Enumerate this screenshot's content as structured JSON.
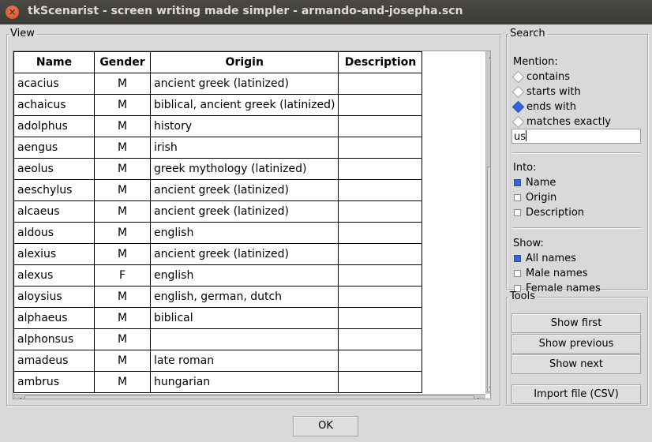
{
  "window": {
    "title": "tkScenarist - screen writing made simpler - armando-and-josepha.scn",
    "close_glyph": "×"
  },
  "view": {
    "legend": "View",
    "columns": [
      "Name",
      "Gender",
      "Origin",
      "Description"
    ],
    "rows": [
      [
        "acacius",
        "M",
        "ancient greek (latinized)",
        ""
      ],
      [
        "achaicus",
        "M",
        "biblical, ancient greek (latinized)",
        ""
      ],
      [
        "adolphus",
        "M",
        "history",
        ""
      ],
      [
        "aengus",
        "M",
        "irish",
        ""
      ],
      [
        "aeolus",
        "M",
        "greek mythology (latinized)",
        ""
      ],
      [
        "aeschylus",
        "M",
        "ancient greek (latinized)",
        ""
      ],
      [
        "alcaeus",
        "M",
        "ancient greek (latinized)",
        ""
      ],
      [
        "aldous",
        "M",
        "english",
        ""
      ],
      [
        "alexius",
        "M",
        "ancient greek (latinized)",
        ""
      ],
      [
        "alexus",
        "F",
        "english",
        ""
      ],
      [
        "aloysius",
        "M",
        "english, german, dutch",
        ""
      ],
      [
        "alphaeus",
        "M",
        "biblical",
        ""
      ],
      [
        "alphonsus",
        "M",
        "",
        ""
      ],
      [
        "amadeus",
        "M",
        "late roman",
        ""
      ],
      [
        "ambrus",
        "M",
        "hungarian",
        ""
      ]
    ],
    "scroll_glyphs": {
      "up": "▲",
      "down": "▼",
      "left": "◀",
      "right": "▶"
    }
  },
  "search": {
    "legend": "Search",
    "mention_label": "Mention:",
    "mention_options": [
      {
        "label": "contains",
        "selected": false
      },
      {
        "label": "starts with",
        "selected": false
      },
      {
        "label": "ends with",
        "selected": true
      },
      {
        "label": "matches exactly",
        "selected": false
      }
    ],
    "query": "us",
    "into_label": "Into:",
    "into_options": [
      {
        "label": "Name",
        "checked": true
      },
      {
        "label": "Origin",
        "checked": false
      },
      {
        "label": "Description",
        "checked": false
      }
    ],
    "show_label": "Show:",
    "show_options": [
      {
        "label": "All names",
        "checked": true
      },
      {
        "label": "Male names",
        "checked": false
      },
      {
        "label": "Female names",
        "checked": false
      }
    ]
  },
  "tools": {
    "legend": "Tools",
    "show_first": "Show first",
    "show_previous": "Show previous",
    "show_next": "Show next",
    "import_file": "Import file (CSV)"
  },
  "ok_label": "OK",
  "colors": {
    "accent": "#3464d8",
    "titlebar": "#3c3b37",
    "close": "#dd4c21"
  }
}
